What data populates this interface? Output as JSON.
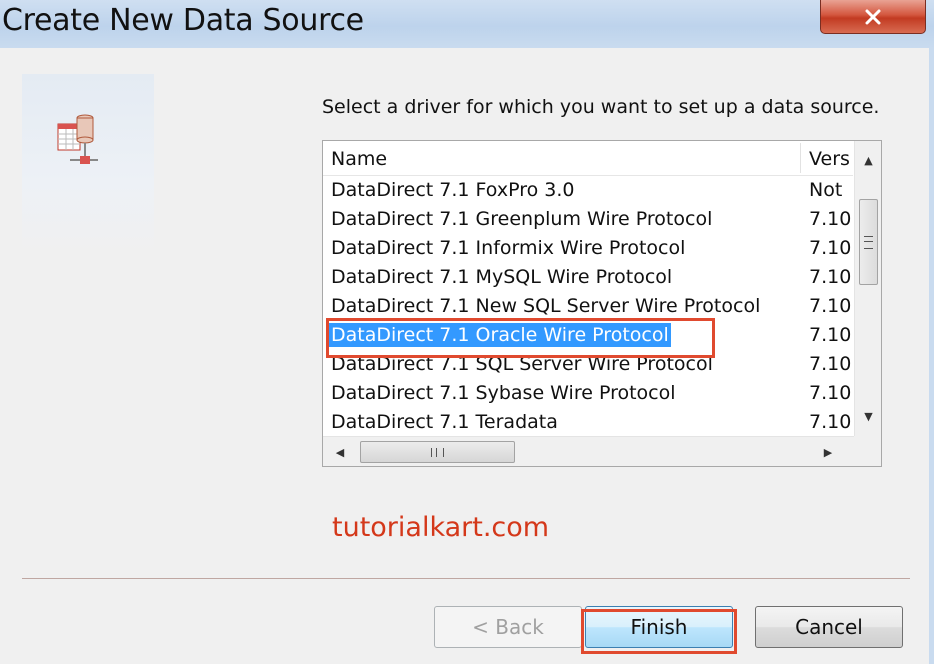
{
  "window": {
    "title": "Create New Data Source",
    "close_icon": "close-x-icon"
  },
  "side_panel": {
    "icon": "data-source-icon"
  },
  "instruction": "Select a driver for which you want to set up a data source.",
  "driver_list": {
    "columns": [
      "Name",
      "Vers"
    ],
    "rows": [
      {
        "name": "DataDirect 7.1 FoxPro 3.0",
        "version": "Not"
      },
      {
        "name": "DataDirect 7.1 Greenplum Wire Protocol",
        "version": "7.10"
      },
      {
        "name": "DataDirect 7.1 Informix Wire Protocol",
        "version": "7.10"
      },
      {
        "name": "DataDirect 7.1 MySQL Wire Protocol",
        "version": "7.10"
      },
      {
        "name": "DataDirect 7.1 New SQL Server Wire Protocol",
        "version": "7.10"
      },
      {
        "name": "DataDirect 7.1 Oracle Wire Protocol",
        "version": "7.10"
      },
      {
        "name": "DataDirect 7.1 SQL Server Wire Protocol",
        "version": "7.10"
      },
      {
        "name": "DataDirect 7.1 Sybase Wire Protocol",
        "version": "7.10"
      },
      {
        "name": "DataDirect 7.1 Teradata",
        "version": "7.10"
      }
    ],
    "selected_index": 5
  },
  "watermark": "tutorialkart.com",
  "buttons": {
    "back": "< Back",
    "finish": "Finish",
    "cancel": "Cancel"
  },
  "colors": {
    "selection": "#3399ff",
    "annotation": "#e04a2f",
    "watermark": "#d4381a"
  }
}
